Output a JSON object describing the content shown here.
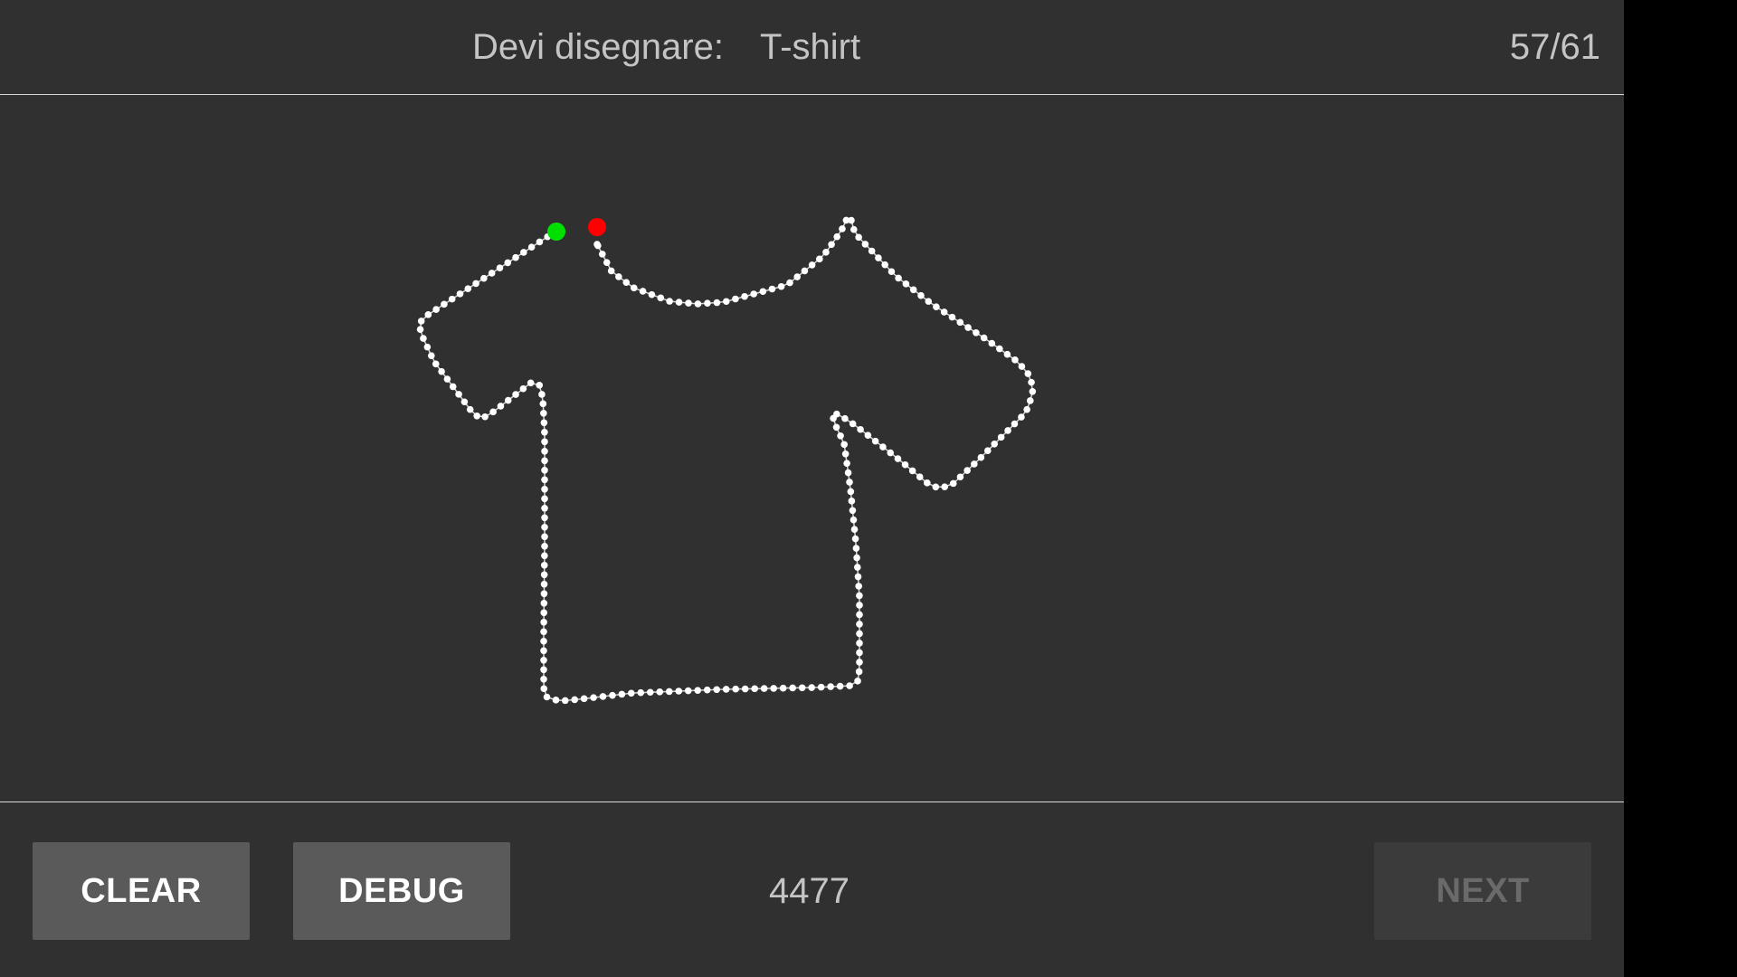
{
  "header": {
    "prompt_label": "Devi disegnare:",
    "prompt_word": "T-shirt",
    "counter": "57/61"
  },
  "canvas": {
    "stroke_color": "#ffffff",
    "start_marker_color": "#00e000",
    "end_marker_color": "#ff0000"
  },
  "footer": {
    "clear_label": "CLEAR",
    "debug_label": "DEBUG",
    "score": "4477",
    "next_label": "NEXT"
  },
  "colors": {
    "background": "#303030",
    "button": "#5a5a5b",
    "button_disabled": "#3b3b3b",
    "text": "#c4c4c4"
  }
}
